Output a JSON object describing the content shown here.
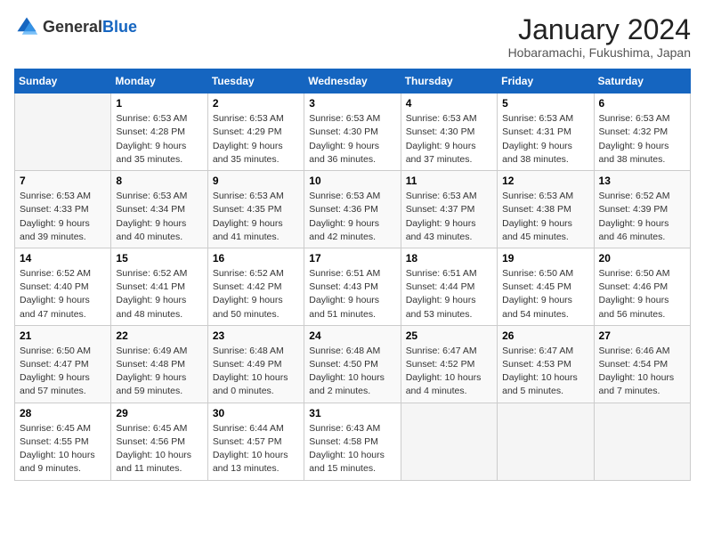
{
  "logo": {
    "general": "General",
    "blue": "Blue"
  },
  "header": {
    "month": "January 2024",
    "location": "Hobaramachi, Fukushima, Japan"
  },
  "days_of_week": [
    "Sunday",
    "Monday",
    "Tuesday",
    "Wednesday",
    "Thursday",
    "Friday",
    "Saturday"
  ],
  "weeks": [
    [
      {
        "day": "",
        "info": ""
      },
      {
        "day": "1",
        "info": "Sunrise: 6:53 AM\nSunset: 4:28 PM\nDaylight: 9 hours\nand 35 minutes."
      },
      {
        "day": "2",
        "info": "Sunrise: 6:53 AM\nSunset: 4:29 PM\nDaylight: 9 hours\nand 35 minutes."
      },
      {
        "day": "3",
        "info": "Sunrise: 6:53 AM\nSunset: 4:30 PM\nDaylight: 9 hours\nand 36 minutes."
      },
      {
        "day": "4",
        "info": "Sunrise: 6:53 AM\nSunset: 4:30 PM\nDaylight: 9 hours\nand 37 minutes."
      },
      {
        "day": "5",
        "info": "Sunrise: 6:53 AM\nSunset: 4:31 PM\nDaylight: 9 hours\nand 38 minutes."
      },
      {
        "day": "6",
        "info": "Sunrise: 6:53 AM\nSunset: 4:32 PM\nDaylight: 9 hours\nand 38 minutes."
      }
    ],
    [
      {
        "day": "7",
        "info": "Sunrise: 6:53 AM\nSunset: 4:33 PM\nDaylight: 9 hours\nand 39 minutes."
      },
      {
        "day": "8",
        "info": "Sunrise: 6:53 AM\nSunset: 4:34 PM\nDaylight: 9 hours\nand 40 minutes."
      },
      {
        "day": "9",
        "info": "Sunrise: 6:53 AM\nSunset: 4:35 PM\nDaylight: 9 hours\nand 41 minutes."
      },
      {
        "day": "10",
        "info": "Sunrise: 6:53 AM\nSunset: 4:36 PM\nDaylight: 9 hours\nand 42 minutes."
      },
      {
        "day": "11",
        "info": "Sunrise: 6:53 AM\nSunset: 4:37 PM\nDaylight: 9 hours\nand 43 minutes."
      },
      {
        "day": "12",
        "info": "Sunrise: 6:53 AM\nSunset: 4:38 PM\nDaylight: 9 hours\nand 45 minutes."
      },
      {
        "day": "13",
        "info": "Sunrise: 6:52 AM\nSunset: 4:39 PM\nDaylight: 9 hours\nand 46 minutes."
      }
    ],
    [
      {
        "day": "14",
        "info": "Sunrise: 6:52 AM\nSunset: 4:40 PM\nDaylight: 9 hours\nand 47 minutes."
      },
      {
        "day": "15",
        "info": "Sunrise: 6:52 AM\nSunset: 4:41 PM\nDaylight: 9 hours\nand 48 minutes."
      },
      {
        "day": "16",
        "info": "Sunrise: 6:52 AM\nSunset: 4:42 PM\nDaylight: 9 hours\nand 50 minutes."
      },
      {
        "day": "17",
        "info": "Sunrise: 6:51 AM\nSunset: 4:43 PM\nDaylight: 9 hours\nand 51 minutes."
      },
      {
        "day": "18",
        "info": "Sunrise: 6:51 AM\nSunset: 4:44 PM\nDaylight: 9 hours\nand 53 minutes."
      },
      {
        "day": "19",
        "info": "Sunrise: 6:50 AM\nSunset: 4:45 PM\nDaylight: 9 hours\nand 54 minutes."
      },
      {
        "day": "20",
        "info": "Sunrise: 6:50 AM\nSunset: 4:46 PM\nDaylight: 9 hours\nand 56 minutes."
      }
    ],
    [
      {
        "day": "21",
        "info": "Sunrise: 6:50 AM\nSunset: 4:47 PM\nDaylight: 9 hours\nand 57 minutes."
      },
      {
        "day": "22",
        "info": "Sunrise: 6:49 AM\nSunset: 4:48 PM\nDaylight: 9 hours\nand 59 minutes."
      },
      {
        "day": "23",
        "info": "Sunrise: 6:48 AM\nSunset: 4:49 PM\nDaylight: 10 hours\nand 0 minutes."
      },
      {
        "day": "24",
        "info": "Sunrise: 6:48 AM\nSunset: 4:50 PM\nDaylight: 10 hours\nand 2 minutes."
      },
      {
        "day": "25",
        "info": "Sunrise: 6:47 AM\nSunset: 4:52 PM\nDaylight: 10 hours\nand 4 minutes."
      },
      {
        "day": "26",
        "info": "Sunrise: 6:47 AM\nSunset: 4:53 PM\nDaylight: 10 hours\nand 5 minutes."
      },
      {
        "day": "27",
        "info": "Sunrise: 6:46 AM\nSunset: 4:54 PM\nDaylight: 10 hours\nand 7 minutes."
      }
    ],
    [
      {
        "day": "28",
        "info": "Sunrise: 6:45 AM\nSunset: 4:55 PM\nDaylight: 10 hours\nand 9 minutes."
      },
      {
        "day": "29",
        "info": "Sunrise: 6:45 AM\nSunset: 4:56 PM\nDaylight: 10 hours\nand 11 minutes."
      },
      {
        "day": "30",
        "info": "Sunrise: 6:44 AM\nSunset: 4:57 PM\nDaylight: 10 hours\nand 13 minutes."
      },
      {
        "day": "31",
        "info": "Sunrise: 6:43 AM\nSunset: 4:58 PM\nDaylight: 10 hours\nand 15 minutes."
      },
      {
        "day": "",
        "info": ""
      },
      {
        "day": "",
        "info": ""
      },
      {
        "day": "",
        "info": ""
      }
    ]
  ]
}
